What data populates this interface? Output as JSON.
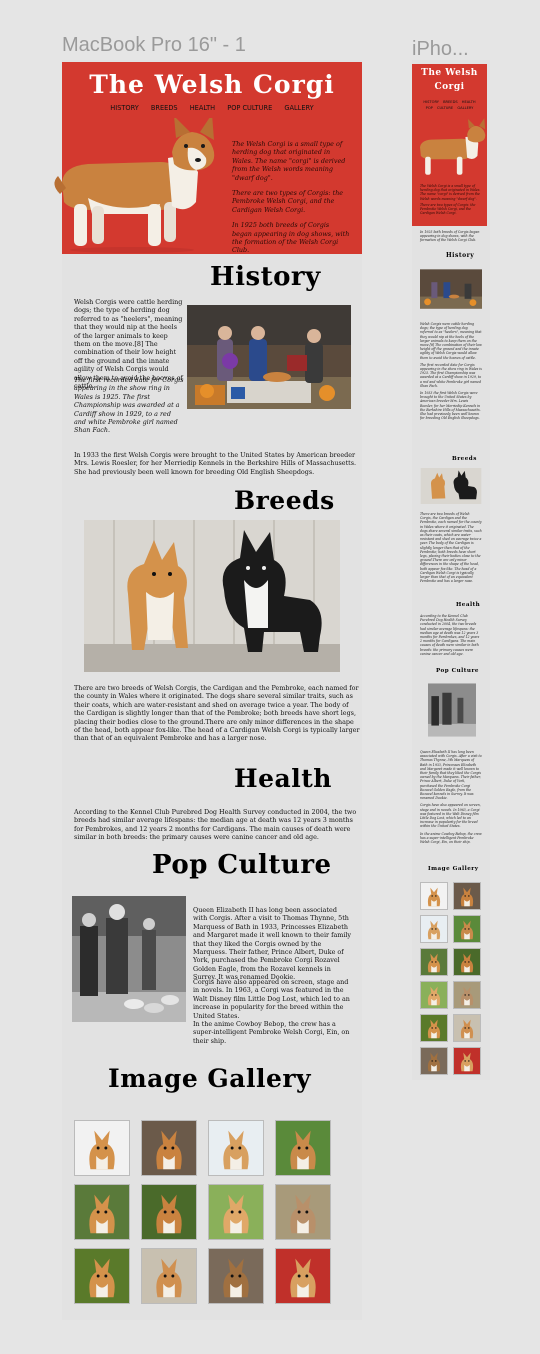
{
  "frames": {
    "desktop": "MacBook Pro 16\" - 1",
    "mobile": "iPho..."
  },
  "site": {
    "title": "The Welsh Corgi",
    "nav": [
      "HISTORY",
      "BREEDS",
      "HEALTH",
      "POP CULTURE",
      "GALLERY"
    ],
    "intro": [
      "The Welsh Corgi is a small type of herding dog that originated in Wales. The name \"corgi\" is derived from the Welsh words meaning \"dwarf dog\".",
      "There are two types of Corgis: the Pembroke Welsh Corgi, and the Cardigan Welsh Corgi.",
      "In 1925 both breeds of Corgis began appearing in dog shows, with the formation of the Welsh Corgi Club."
    ]
  },
  "history": {
    "heading": "History",
    "p1": "Welsh Corgis were cattle herding dogs; the type of herding dog referred to as \"heelers\", meaning that they would nip at the heels of the larger animals to keep them on the move.[8] The combination of their low height off the ground and the innate agility of Welsh Corgis would allow them to avoid the hooves of cattle.",
    "p2": "The first recorded date for Corgis appearing in the show ring in Wales is 1925. The first Championship was awarded at a Cardiff show in 1929, to a red and white Pembroke girl named Shan Fach.",
    "p3": "In 1933 the first Welsh Corgis were brought to the United States by American breeder Mrs. Lewis Roesler, for her Merriedip Kennels in the Berkshire Hills of Massachusetts. She had previously been well known for breeding Old English Sheepdogs."
  },
  "breeds": {
    "heading": "Breeds",
    "p": "There are two breeds of Welsh Corgis, the Cardigan and the Pembroke, each named for the county in Wales where it originated. The dogs share several similar traits, such as their coats, which are water-resistant and shed on average twice a year. The body of the Cardigan is slightly longer than that of the Pembroke; both breeds have short legs, placing their bodies close to the ground.There are only minor differences in the shape of the head, both appear fox-like. The head of a Cardigan Welsh Corgi is typically larger than that of an equivalent Pembroke and has a larger nose."
  },
  "health": {
    "heading": "Health",
    "p": "According to the Kennel Club Purebred Dog Health Survey conducted in 2004, the two breeds had similar average lifespans: the median age at death was 12 years 3 months for Pembrokes, and 12 years 2 months for Cardigans. The main causes of death were similar in both breeds: the primary causes were canine cancer and old age."
  },
  "pop": {
    "heading": "Pop Culture",
    "p1": "Queen Elizabeth II has long been associated with Corgis. After a visit to Thomas Thynne, 5th Marquess of Bath in 1933, Princesses Elizabeth and Margaret made it well known to their family that they liked the Corgis owned by the Marquess. Their father, Prince Albert, Duke of York, purchased the Pembroke Corgi Rozavel Golden Eagle, from the Rozavel kennels in Surrey. It was renamed Dookie.",
    "p2": "Corgis have also appeared on screen, stage and in novels. In 1963, a Corgi was featured in the Walt Disney film Little Dog Lost, which led to an increase in popularity for the breed within the United States.",
    "p3": "In the anime Cowboy Bebop, the crew has a super-intelligent Pembroke Welsh Corgi, Ein, on their ship."
  },
  "gallery": {
    "heading": "Image Gallery"
  },
  "mobile": {
    "title1": "The Welsh",
    "title2": "Corgi",
    "nav1": [
      "HISTORY",
      "BREEDS",
      "HEALTH"
    ],
    "nav2": [
      "POP CULTURE",
      "GALLERY"
    ]
  },
  "colors": {
    "hero": "#d3392f",
    "background": "#e2e2e2"
  }
}
